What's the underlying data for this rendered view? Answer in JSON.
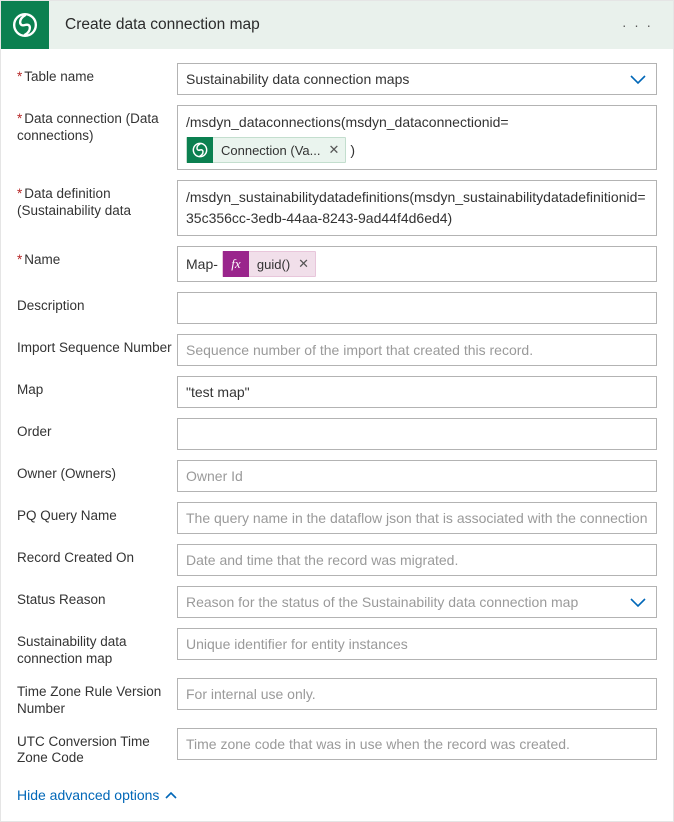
{
  "header": {
    "title": "Create data connection map",
    "icon": "swirl-icon"
  },
  "fields": {
    "tableName": {
      "label": "Table name",
      "required": true,
      "value": "Sustainability data connection maps",
      "type": "dropdown"
    },
    "dataConnection": {
      "label": "Data connection (Data connections)",
      "required": true,
      "prefix": "/msdyn_dataconnections(msdyn_dataconnectionid=",
      "pillLabel": "Connection (Va...",
      "suffix": ")"
    },
    "dataDefinition": {
      "label": "Data definition (Sustainability data",
      "required": true,
      "value": "/msdyn_sustainabilitydatadefinitions(msdyn_sustainabilitydatadefinitionid=35c356cc-3edb-44aa-8243-9ad44f4d6ed4)"
    },
    "name": {
      "label": "Name",
      "required": true,
      "prefix": "Map-",
      "pillLabel": "guid()",
      "pillIcon": "fx"
    },
    "description": {
      "label": "Description",
      "required": false,
      "value": "",
      "placeholder": ""
    },
    "importSeq": {
      "label": "Import Sequence Number",
      "required": false,
      "value": "",
      "placeholder": "Sequence number of the import that created this record."
    },
    "map": {
      "label": "Map",
      "required": false,
      "value": "\"test map\"",
      "placeholder": ""
    },
    "order": {
      "label": "Order",
      "required": false,
      "value": "",
      "placeholder": ""
    },
    "owner": {
      "label": "Owner (Owners)",
      "required": false,
      "value": "",
      "placeholder": "Owner Id"
    },
    "pqQuery": {
      "label": "PQ Query Name",
      "required": false,
      "value": "",
      "placeholder": "The query name in the dataflow json that is associated with the connection map"
    },
    "recordCreated": {
      "label": "Record Created On",
      "required": false,
      "value": "",
      "placeholder": "Date and time that the record was migrated."
    },
    "statusReason": {
      "label": "Status Reason",
      "required": false,
      "value": "",
      "placeholder": "Reason for the status of the Sustainability data connection map",
      "type": "dropdown"
    },
    "sustMap": {
      "label": "Sustainability data connection map",
      "required": false,
      "value": "",
      "placeholder": "Unique identifier for entity instances"
    },
    "tzRule": {
      "label": "Time Zone Rule Version Number",
      "required": false,
      "value": "",
      "placeholder": "For internal use only."
    },
    "utcConv": {
      "label": "UTC Conversion Time Zone Code",
      "required": false,
      "value": "",
      "placeholder": "Time zone code that was in use when the record was created."
    }
  },
  "footer": {
    "hideAdvanced": "Hide advanced options"
  },
  "colors": {
    "headerBg": "#e9f1ec",
    "brand": "#0b8050",
    "formula": "#9a258c",
    "link": "#0067b8",
    "required": "#b62828"
  }
}
